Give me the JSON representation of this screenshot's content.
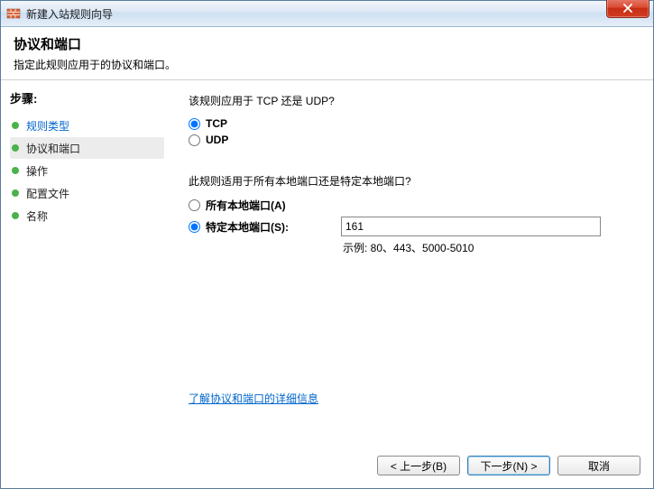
{
  "window": {
    "title": "新建入站规则向导"
  },
  "header": {
    "title": "协议和端口",
    "subtitle": "指定此规则应用于的协议和端口。"
  },
  "sidebar": {
    "steps_label": "步骤:",
    "items": [
      {
        "label": "规则类型",
        "link": true,
        "highlight": false
      },
      {
        "label": "协议和端口",
        "link": false,
        "highlight": true
      },
      {
        "label": "操作",
        "link": false,
        "highlight": false
      },
      {
        "label": "配置文件",
        "link": false,
        "highlight": false
      },
      {
        "label": "名称",
        "link": false,
        "highlight": false
      }
    ]
  },
  "content": {
    "q1": "该规则应用于 TCP 还是 UDP?",
    "tcp_label": "TCP",
    "udp_label": "UDP",
    "q2": "此规则适用于所有本地端口还是特定本地端口?",
    "all_ports_label": "所有本地端口(A)",
    "specific_ports_label": "特定本地端口(S):",
    "port_value": "161",
    "example": "示例: 80、443、5000-5010",
    "learn_more": "了解协议和端口的详细信息"
  },
  "footer": {
    "back": "< 上一步(B)",
    "next": "下一步(N) >",
    "cancel": "取消"
  }
}
